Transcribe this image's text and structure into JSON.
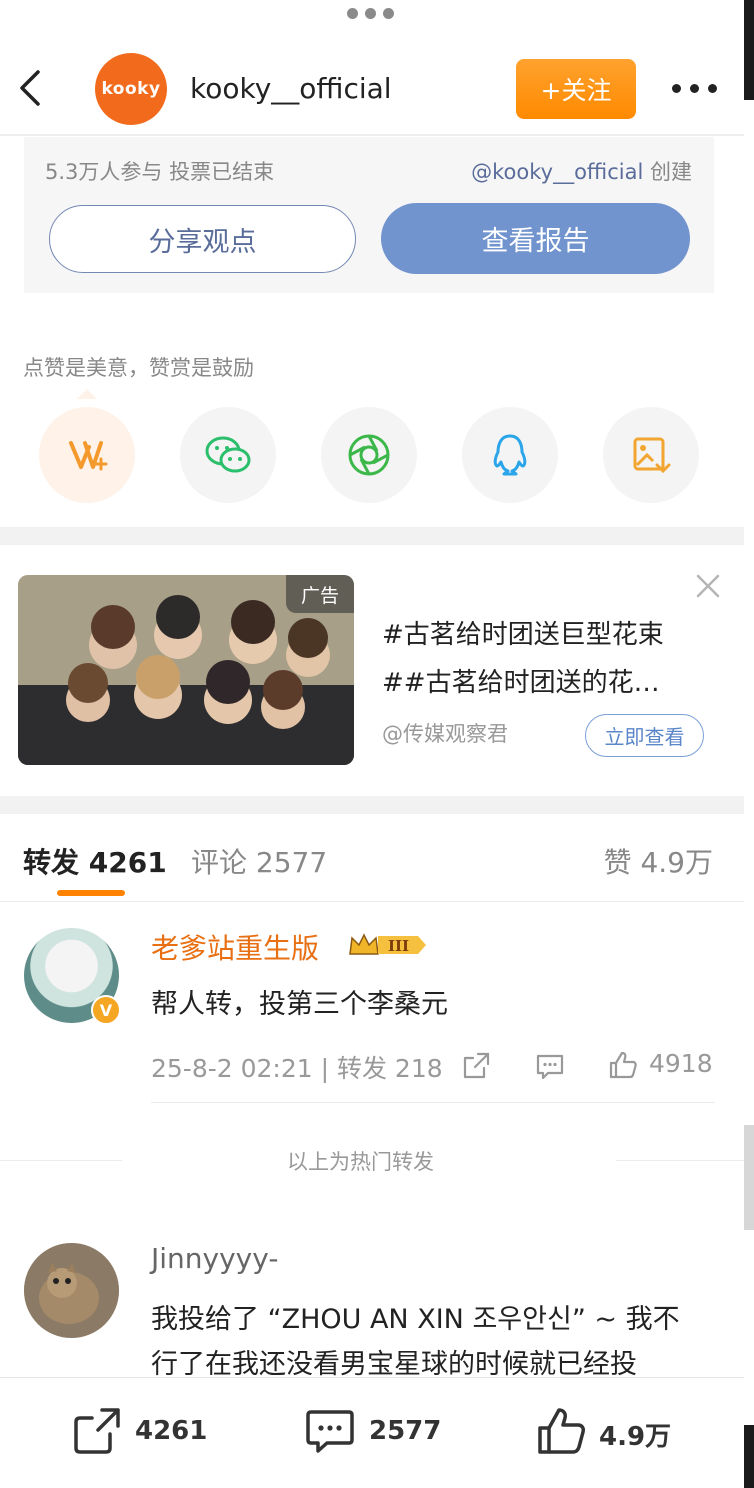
{
  "header": {
    "avatar_text": "kooky",
    "username": "kooky__official",
    "follow_label": "+关注"
  },
  "poll": {
    "meta": "5.3万人参与  投票已结束",
    "creator_mention": "@kooky__official",
    "creator_suffix": " 创建",
    "share_label": "分享观点",
    "report_label": "查看报告"
  },
  "tip": {
    "text": "点赞是美意，赞赏是鼓励"
  },
  "share_icons": [
    "reward-icon",
    "wechat-icon",
    "moments-icon",
    "qq-icon",
    "save-image-icon"
  ],
  "ad": {
    "badge": "广告",
    "line1": "#古茗给时团送巨型花束",
    "line2": "##古茗给时团送的花…",
    "source": "@传媒观察君",
    "view_label": "立即查看"
  },
  "tabs": {
    "repost": "转发 4261",
    "comment": "评论 2577",
    "like": "赞 4.9万"
  },
  "hot_reposts": [
    {
      "name": "老爹站重生版",
      "text": "帮人转，投第三个李桑元",
      "meta": "25-8-2 02:21 | 转发 218",
      "likes": "4918"
    }
  ],
  "hot_divider": "以上为热门转发",
  "reposts": [
    {
      "name": "Jinnyyyy-",
      "text_line1": "我投给了 “ZHOU AN XIN 조우안신” ~ 我不",
      "text_line2": "行了在我还没看男宝星球的时候就已经投"
    }
  ],
  "bottom_bar": {
    "repost_count": "4261",
    "comment_count": "2577",
    "like_count": "4.9万"
  },
  "colors": {
    "accent_orange": "#ff8200",
    "report_blue": "#7194ce",
    "link_blue": "#5a6d9a"
  }
}
